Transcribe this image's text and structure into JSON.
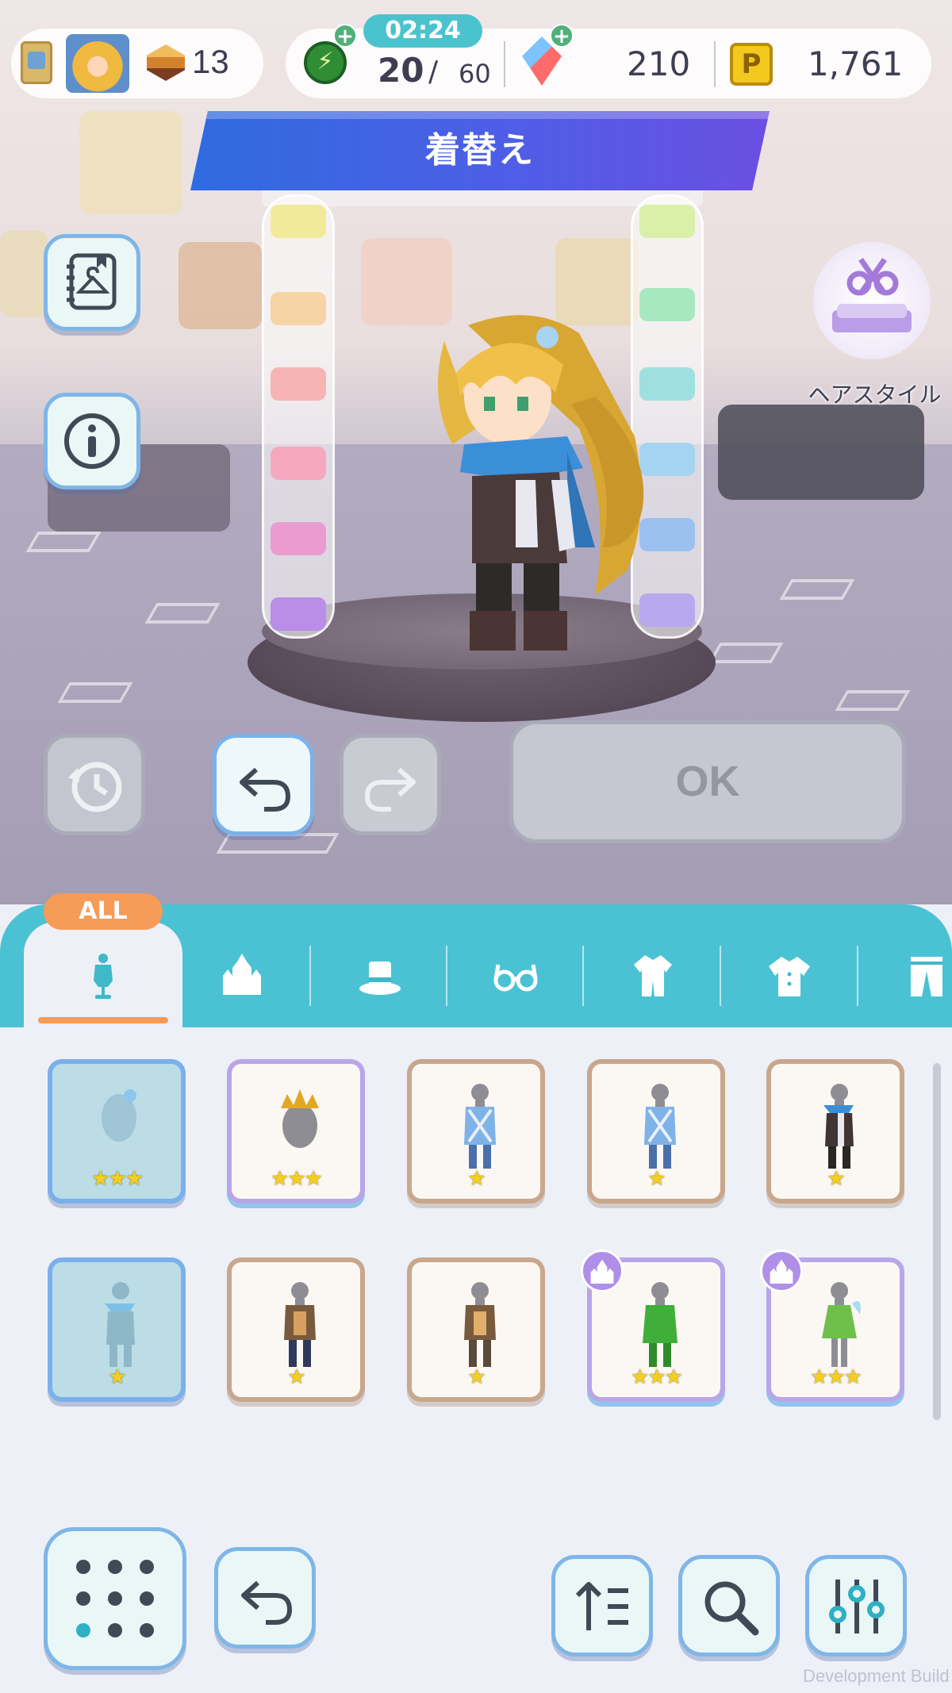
{
  "hud": {
    "rank_value": "13",
    "timer": "02:24",
    "stamina_current": "20",
    "stamina_sep": "/",
    "stamina_max": "60",
    "gem_value": "210",
    "coin_symbol": "P",
    "coin_value": "1,761"
  },
  "title": "着替え",
  "hair_style_label": "ヘアスタイル",
  "actions": {
    "ok_label": "OK"
  },
  "tabs": {
    "all_badge": "ALL",
    "items": [
      {
        "icon": "mannequin-icon",
        "active": true
      },
      {
        "icon": "castle-icon",
        "active": false
      },
      {
        "icon": "hat-icon",
        "active": false
      },
      {
        "icon": "glasses-icon",
        "active": false
      },
      {
        "icon": "outfit-icon",
        "active": false
      },
      {
        "icon": "shirt-icon",
        "active": false
      },
      {
        "icon": "pants-icon",
        "active": false
      }
    ]
  },
  "items": [
    {
      "stars": "★★★",
      "type": "hair-item",
      "equipped": true
    },
    {
      "stars": "★★★",
      "type": "crown-hair-item",
      "rare": true
    },
    {
      "stars": "★",
      "type": "blue-armor-item"
    },
    {
      "stars": "★",
      "type": "blue-armor-item"
    },
    {
      "stars": "★",
      "type": "dark-coat-item"
    },
    {
      "stars": "★",
      "type": "blue-outfit-item",
      "equipped": true
    },
    {
      "stars": "★",
      "type": "brown-outfit-item"
    },
    {
      "stars": "★",
      "type": "brown-outfit-item"
    },
    {
      "stars": "★★★",
      "type": "green-outfit-item",
      "rare": true,
      "castle_badge": true
    },
    {
      "stars": "★★★",
      "type": "fairy-outfit-item",
      "rare": true,
      "castle_badge": true
    }
  ],
  "dev_build": "Development Build",
  "colors": {
    "accent": "#4bc2d3",
    "tab_active_underline": "#f69b58",
    "banner": "#4e5ee6",
    "star": "#f6cf1e"
  }
}
